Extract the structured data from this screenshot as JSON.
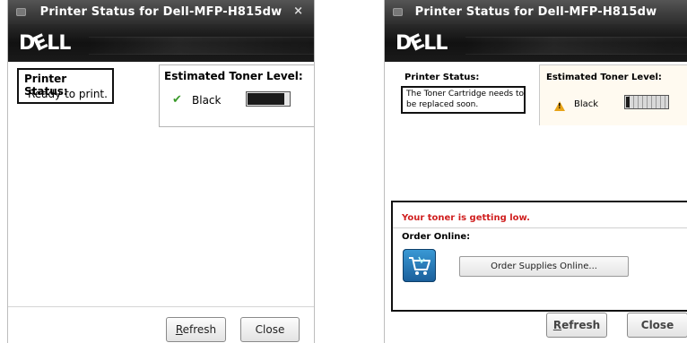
{
  "left_window": {
    "title": "Printer Status for Dell-MFP-H815dw",
    "close_glyph": "×",
    "logo": {
      "d": "D",
      "e": "E",
      "ll": "LL"
    },
    "status": {
      "heading": "Printer Status:",
      "message": "Ready to print."
    },
    "toner": {
      "heading": "Estimated Toner Level:",
      "color_label": "Black",
      "status_icon": "checkmark-icon",
      "level": 0.9
    },
    "buttons": {
      "refresh_mnemonic": "R",
      "refresh_rest": "efresh",
      "close": "Close"
    }
  },
  "right_window": {
    "title": "Printer Status for Dell-MFP-H815dw",
    "logo": {
      "d": "D",
      "e": "E",
      "ll": "LL"
    },
    "status": {
      "heading": "Printer Status:",
      "message": "The Toner Cartridge needs to be replaced soon."
    },
    "toner": {
      "heading": "Estimated Toner Level:",
      "color_label": "Black",
      "status_icon": "warning-icon",
      "level": 0.12
    },
    "alert": "Your toner is getting low.",
    "order_heading": "Order Online:",
    "order_button_mnemonic": "O",
    "order_button_rest": "rder Supplies Online...",
    "buttons": {
      "refresh_mnemonic": "R",
      "refresh_rest": "efresh",
      "close": "Close"
    }
  },
  "colors": {
    "alert_text": "#d02020",
    "check_green": "#3a9a2a",
    "warning_yellow": "#e8a317"
  }
}
